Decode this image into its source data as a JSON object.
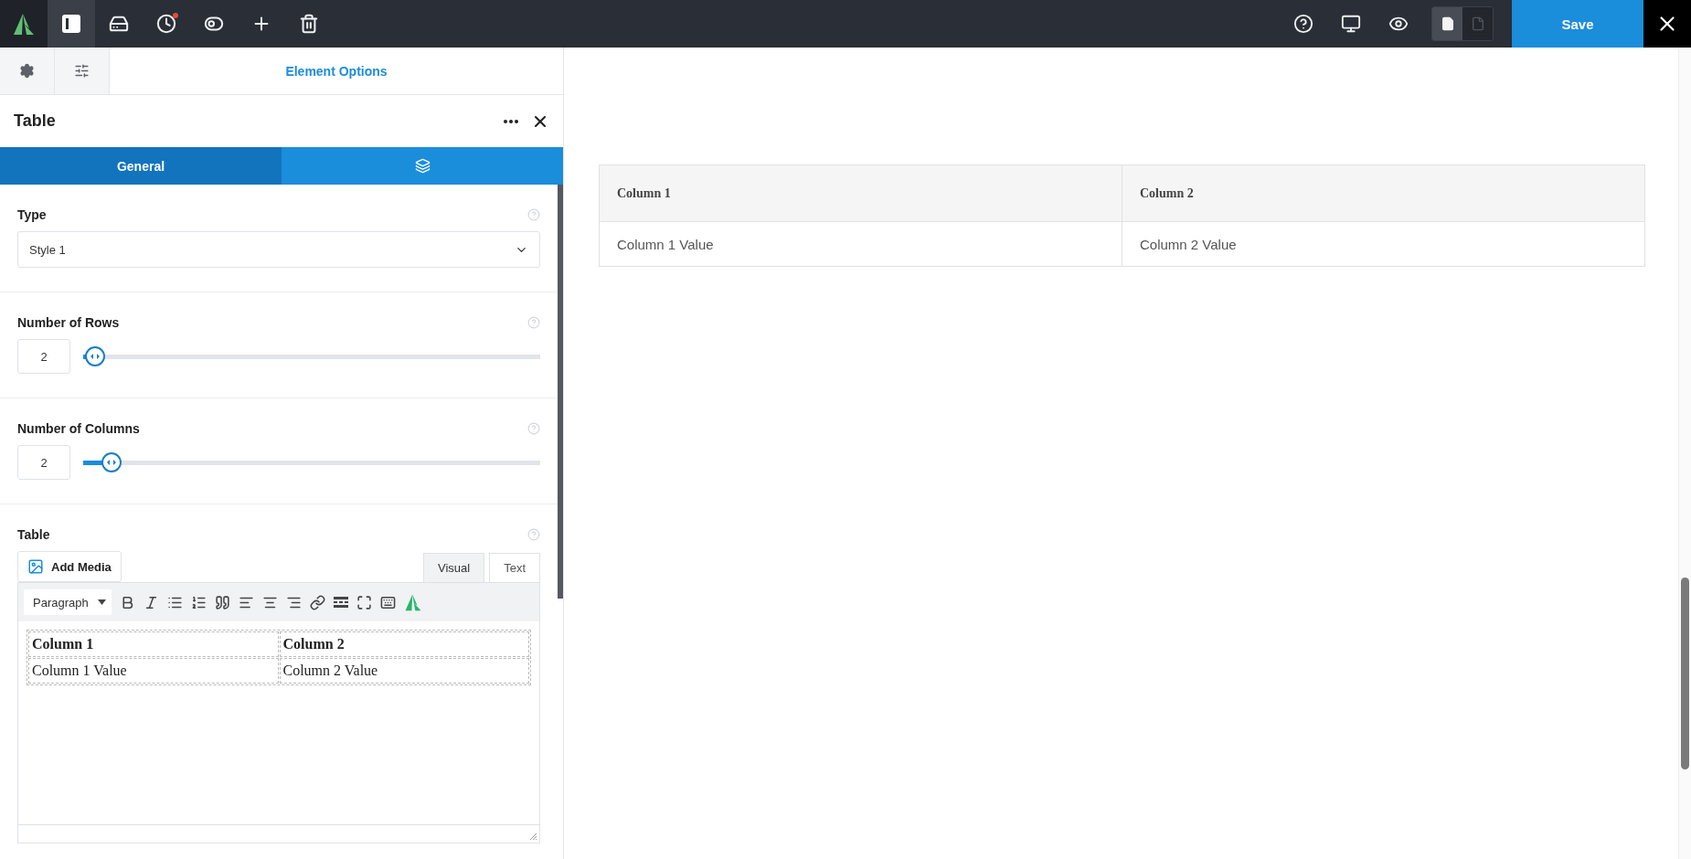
{
  "topbar": {
    "tools": [
      {
        "kind": "sidebar",
        "selected": true,
        "badge": false
      },
      {
        "kind": "drawer",
        "selected": false,
        "badge": false
      },
      {
        "kind": "history",
        "selected": false,
        "badge": true
      },
      {
        "kind": "toggles",
        "selected": false,
        "badge": false
      },
      {
        "kind": "add",
        "selected": false,
        "badge": false
      },
      {
        "kind": "delete",
        "selected": false,
        "badge": false
      }
    ],
    "actions": [
      {
        "kind": "help"
      },
      {
        "kind": "desktop"
      },
      {
        "kind": "preview"
      }
    ],
    "views": [
      {
        "kind": "filled",
        "selected": true
      },
      {
        "kind": "outline",
        "selected": false
      }
    ],
    "save": "Save"
  },
  "panel": {
    "tabs": [
      {
        "kind": "settings",
        "selected": false
      },
      {
        "kind": "options",
        "selected": false
      },
      {
        "kind": "label",
        "label": "Element Options",
        "selected": true
      }
    ],
    "title": "Table",
    "subtabs": [
      {
        "kind": "label",
        "label": "General",
        "selected": true
      },
      {
        "kind": "styles",
        "selected": false
      }
    ],
    "fields": [
      {
        "kind": "select",
        "label": "Type",
        "value": "Style 1"
      },
      {
        "kind": "slider",
        "label": "Number of Rows",
        "value": "2",
        "level": 0.01
      },
      {
        "kind": "slider",
        "label": "Number of Columns",
        "value": "2",
        "level": 0.045
      },
      {
        "kind": "editor",
        "label": "Table",
        "add_media": "Add Media",
        "format": "Paragraph",
        "modes": [
          {
            "label": "Visual",
            "selected": true
          },
          {
            "label": "Text",
            "selected": false
          }
        ],
        "table": {
          "columns": [
            "Column 1",
            "Column 2"
          ],
          "rows": [
            [
              "Column 1 Value",
              "Column 2 Value"
            ]
          ]
        }
      }
    ]
  },
  "preview_table": {
    "columns": [
      "Column 1",
      "Column 2"
    ],
    "rows": [
      [
        "Column 1 Value",
        "Column 2 Value"
      ]
    ]
  }
}
